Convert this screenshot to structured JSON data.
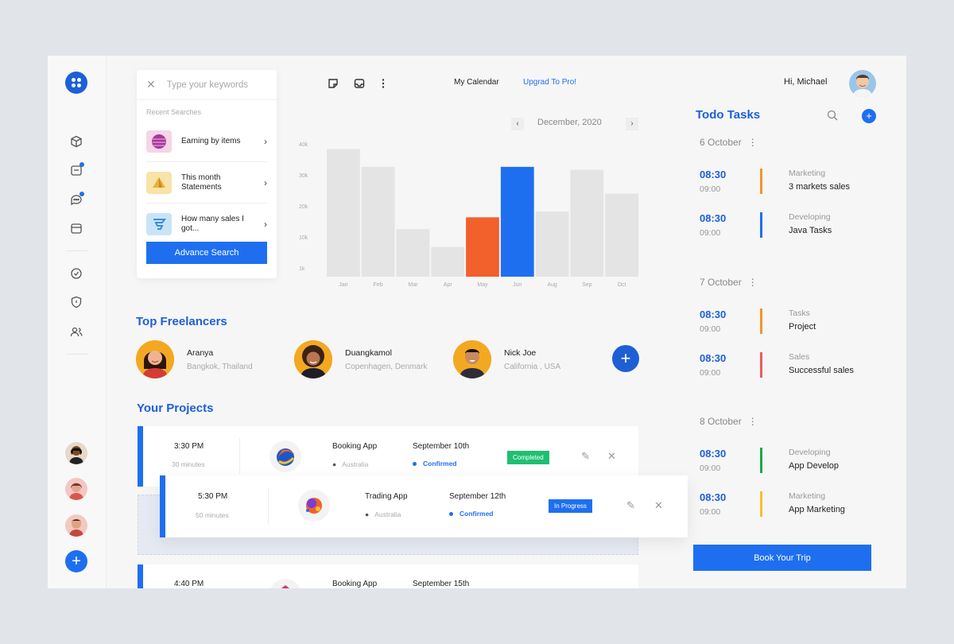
{
  "search": {
    "placeholder": "Type your keywords",
    "recent_title": "Recent Searches",
    "items": [
      {
        "label": "Earning by items"
      },
      {
        "label": "This month Statements"
      },
      {
        "label": "How many sales I got..."
      }
    ],
    "button": "Advance Search"
  },
  "topbar": {
    "calendar": "My Calendar",
    "upgrade": "Upgrad To Pro!",
    "greeting": "Hi, Michael"
  },
  "chart": {
    "month": "December, 2020",
    "accent_colors": {
      "highlight_blue": "#1e6ff0",
      "highlight_orange": "#f2602b",
      "bars": "#e4e4e4"
    }
  },
  "chart_data": {
    "type": "bar",
    "categories": [
      "Jan",
      "Feb",
      "Mar",
      "Apr",
      "May",
      "Jun",
      "Aug",
      "Sep",
      "Oct"
    ],
    "values": [
      43,
      37,
      16,
      10,
      20,
      37,
      22,
      36,
      28
    ],
    "highlighted": [
      "May",
      "Jun"
    ],
    "ytick_labels": [
      "40k",
      "30k",
      "20k",
      "10k",
      "1k"
    ],
    "ylim": [
      0,
      45
    ],
    "title": "",
    "xlabel": "",
    "ylabel": ""
  },
  "freelancers": {
    "title": "Top Freelancers",
    "items": [
      {
        "name": "Aranya",
        "location": "Bangkok, Thailand"
      },
      {
        "name": "Duangkamol",
        "location": "Copenhagen, Denmark"
      },
      {
        "name": "Nick Joe",
        "location": "California , USA"
      }
    ]
  },
  "projects": {
    "title": "Your Projects",
    "items": [
      {
        "time": "3:30 PM",
        "duration": "30 minutes",
        "name": "Booking App",
        "location": "Australia",
        "date": "September 10th",
        "status": "Confirmed",
        "badge": "Completed"
      },
      {
        "time": "5:30 PM",
        "duration": "50 minutes",
        "name": "Trading App",
        "location": "Australia",
        "date": "September 12th",
        "status": "Confirmed",
        "badge": "In Progress"
      },
      {
        "time": "4:40 PM",
        "name": "Booking App",
        "date": "September 15th"
      }
    ]
  },
  "todo": {
    "title": "Todo Tasks",
    "days": [
      {
        "label": "6 October",
        "tasks": [
          {
            "start": "08:30",
            "end": "09:00",
            "category": "Marketing",
            "title": "3 markets sales",
            "color": "#f2952b"
          },
          {
            "start": "08:30",
            "end": "09:00",
            "category": "Developing",
            "title": "Java Tasks",
            "color": "#1e6ff0"
          }
        ]
      },
      {
        "label": "7 October",
        "tasks": [
          {
            "start": "08:30",
            "end": "09:00",
            "category": "Tasks",
            "title": "Project",
            "color": "#f2952b"
          },
          {
            "start": "08:30",
            "end": "09:00",
            "category": "Sales",
            "title": "Successful sales",
            "color": "#f05a5a"
          }
        ]
      },
      {
        "label": "8 October",
        "tasks": [
          {
            "start": "08:30",
            "end": "09:00",
            "category": "Developing",
            "title": "App Develop",
            "color": "#1ea84a"
          },
          {
            "start": "08:30",
            "end": "09:00",
            "category": "Marketing",
            "title": "App Marketing",
            "color": "#f5c02b"
          }
        ]
      }
    ],
    "button": "Book Your Trip"
  }
}
